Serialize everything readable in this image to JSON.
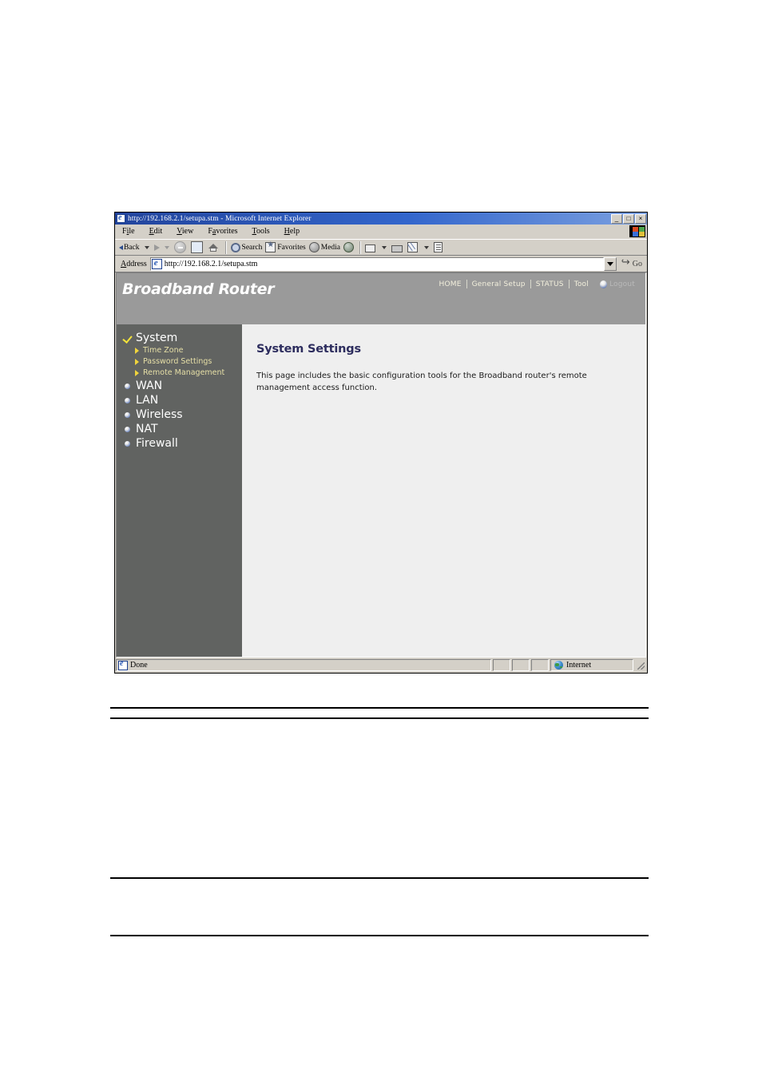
{
  "browser": {
    "title": "http://192.168.2.1/setupa.stm - Microsoft Internet Explorer",
    "window_controls": {
      "minimize": "_",
      "maximize": "□",
      "close": "×"
    },
    "menu": [
      {
        "pre": "F",
        "accel": "i",
        "post": "le"
      },
      {
        "pre": "",
        "accel": "E",
        "post": "dit"
      },
      {
        "pre": "",
        "accel": "V",
        "post": "iew"
      },
      {
        "pre": "F",
        "accel": "a",
        "post": "vorites"
      },
      {
        "pre": "",
        "accel": "T",
        "post": "ools"
      },
      {
        "pre": "",
        "accel": "H",
        "post": "elp"
      }
    ],
    "toolbar": {
      "back_label": "Back",
      "search_label": "Search",
      "favorites_label": "Favorites",
      "media_label": "Media"
    },
    "address": {
      "label": "Address",
      "value": "http://192.168.2.1/setupa.stm",
      "go_label": "Go"
    },
    "status": {
      "message": "Done",
      "zone": "Internet"
    }
  },
  "router": {
    "brand": "Broadband Router",
    "topnav": [
      {
        "label": "HOME"
      },
      {
        "label": "General Setup"
      },
      {
        "label": "STATUS"
      },
      {
        "label": "Tool"
      },
      {
        "label": "Logout"
      }
    ],
    "sidebar": [
      {
        "label": "System",
        "marker": "check-mark"
      },
      {
        "label": "Time Zone",
        "marker": "sub-arrow"
      },
      {
        "label": "Password Settings",
        "marker": "sub-arrow"
      },
      {
        "label": "Remote Management",
        "marker": "sub-arrow"
      },
      {
        "label": "WAN",
        "marker": "bullet"
      },
      {
        "label": "LAN",
        "marker": "bullet"
      },
      {
        "label": "Wireless",
        "marker": "bullet"
      },
      {
        "label": "NAT",
        "marker": "bullet"
      },
      {
        "label": "Firewall",
        "marker": "bullet"
      }
    ],
    "content": {
      "heading": "System Settings",
      "paragraph": "This page includes the basic configuration tools for the Broadband router's remote management access function."
    }
  },
  "colors": {
    "banner_bg": "#9a9a9a",
    "sidebar_bg": "#616361",
    "content_bg": "#efefef",
    "heading": "#2d2d5e",
    "sub_item_text": "#e6dfa6",
    "marker_yellow": "#f0d43c",
    "titlebar_blue": "#3366cc"
  }
}
